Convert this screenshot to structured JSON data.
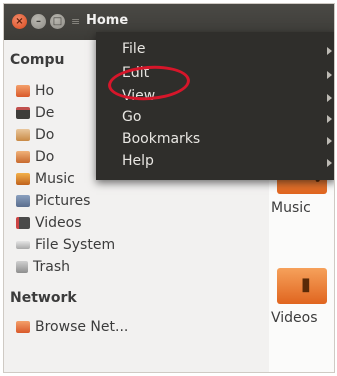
{
  "window": {
    "title": "Home",
    "title_separator": "≡",
    "buttons": [
      "close-icon",
      "minimize-icon",
      "maximize-icon"
    ]
  },
  "sidebar": {
    "computer_heading": "Compu",
    "items": [
      {
        "label": "Ho",
        "icon": "home-folder-icon"
      },
      {
        "label": "De",
        "icon": "desktop-icon"
      },
      {
        "label": "Do",
        "icon": "documents-icon"
      },
      {
        "label": "Do",
        "icon": "downloads-icon"
      },
      {
        "label": "Music",
        "icon": "music-folder-icon"
      },
      {
        "label": "Pictures",
        "icon": "pictures-icon"
      },
      {
        "label": "Videos",
        "icon": "videos-icon"
      },
      {
        "label": "File System",
        "icon": "harddisk-icon"
      },
      {
        "label": "Trash",
        "icon": "trash-icon"
      }
    ],
    "network_heading": "Network",
    "network_items": [
      {
        "label": "Browse Net...",
        "icon": "network-icon"
      }
    ]
  },
  "content": {
    "folders": [
      {
        "label": "Music",
        "glyph": "♫"
      },
      {
        "label": "Videos",
        "glyph": "▮"
      }
    ]
  },
  "menu": {
    "items": [
      {
        "label": "File",
        "has_submenu": true
      },
      {
        "label": "Edit",
        "has_submenu": true,
        "highlighted_by_annotation": true
      },
      {
        "label": "View",
        "has_submenu": true
      },
      {
        "label": "Go",
        "has_submenu": true
      },
      {
        "label": "Bookmarks",
        "has_submenu": true
      },
      {
        "label": "Help",
        "has_submenu": true
      }
    ]
  },
  "colors": {
    "titlebar": "#3c3b37",
    "menu_bg": "#2f2e2b",
    "annotation_circle": "#d6162a",
    "close_button": "#d8491c"
  }
}
